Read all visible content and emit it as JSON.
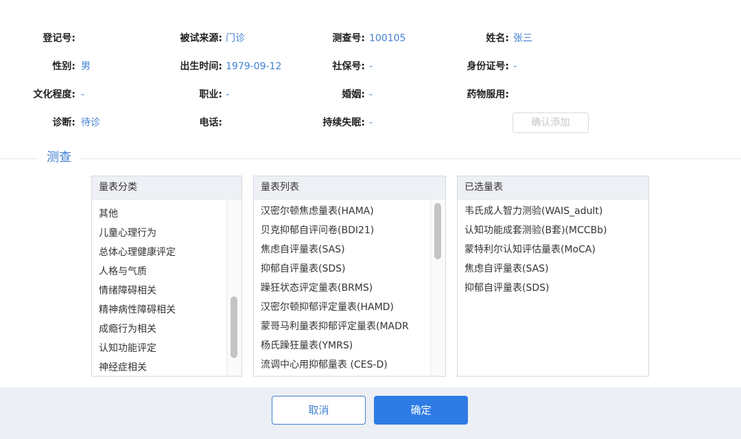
{
  "info": {
    "reg_no": {
      "label": "登记号:",
      "value": ""
    },
    "source": {
      "label": "被试来源:",
      "value": "门诊"
    },
    "test_no": {
      "label": "测查号:",
      "value": "100105"
    },
    "name": {
      "label": "姓名:",
      "value": "张三"
    },
    "gender": {
      "label": "性别:",
      "value": "男"
    },
    "birth": {
      "label": "出生时间:",
      "value": "1979-09-12"
    },
    "social_no": {
      "label": "社保号:",
      "value": "-"
    },
    "id_no": {
      "label": "身份证号:",
      "value": "-"
    },
    "education": {
      "label": "文化程度:",
      "value": "-"
    },
    "job": {
      "label": "职业:",
      "value": "-"
    },
    "marriage": {
      "label": "婚姻:",
      "value": "-"
    },
    "medication": {
      "label": "药物服用:",
      "value": ""
    },
    "diagnosis": {
      "label": "诊断:",
      "value": "待诊"
    },
    "phone": {
      "label": "电话:",
      "value": ""
    },
    "insomnia": {
      "label": "持续失眠:",
      "value": "-"
    }
  },
  "confirm_add_label": "确认添加",
  "section_title": "测查",
  "panels": {
    "category": {
      "title": "量表分类",
      "items": [
        "其他",
        "儿童心理行为",
        "总体心理健康评定",
        "人格与气质",
        "情绪障碍相关",
        "精神病性障碍相关",
        "成瘾行为相关",
        "认知功能评定",
        "神经症相关"
      ]
    },
    "list": {
      "title": "量表列表",
      "items": [
        "汉密尔顿焦虑量表(HAMA)",
        "贝克抑郁自评问卷(BDI21)",
        "焦虑自评量表(SAS)",
        "抑郁自评量表(SDS)",
        "躁狂状态评定量表(BRMS)",
        "汉密尔顿抑郁评定量表(HAMD)",
        "蒙哥马利量表抑郁评定量表(MADR",
        "杨氏躁狂量表(YMRS)",
        "流调中心用抑郁量表 (CES-D)"
      ]
    },
    "selected": {
      "title": "已选量表",
      "items": [
        "韦氏成人智力测验(WAIS_adult)",
        "认知功能成套测验(B套)(MCCBb)",
        "蒙特利尔认知评估量表(MoCA)",
        "焦虑自评量表(SAS)",
        "抑郁自评量表(SDS)"
      ]
    }
  },
  "footer": {
    "cancel_label": "取消",
    "ok_label": "确定"
  }
}
